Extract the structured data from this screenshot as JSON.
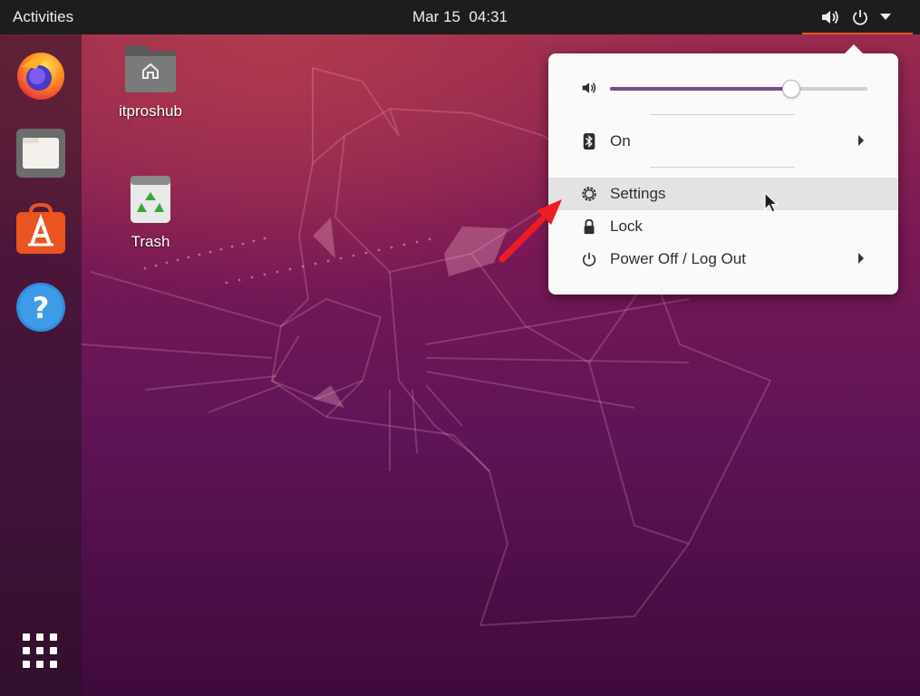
{
  "topbar": {
    "activities_label": "Activities",
    "date": "Mar 15",
    "time": "04:31",
    "tray_icons": [
      "volume-icon",
      "power-icon",
      "dropdown-arrow-icon"
    ],
    "accent": "#e95420"
  },
  "dock": {
    "items": [
      "firefox-icon",
      "files-icon",
      "software-icon",
      "help-icon"
    ],
    "show_apps_icon": "app-grid-icon"
  },
  "desktop": {
    "icons": [
      {
        "label": "itproshub",
        "icon": "home-folder-icon"
      },
      {
        "label": "Trash",
        "icon": "trash-icon"
      }
    ]
  },
  "menu": {
    "volume": {
      "icon": "volume-icon",
      "level_percent": 70
    },
    "bluetooth": {
      "icon": "bluetooth-icon",
      "label": "On"
    },
    "settings": {
      "icon": "settings-gear-icon",
      "label": "Settings"
    },
    "lock": {
      "icon": "lock-icon",
      "label": "Lock"
    },
    "power": {
      "icon": "power-icon",
      "label": "Power Off / Log Out"
    }
  },
  "colors": {
    "menu_bg": "#fafafa",
    "topbar_bg": "#1d1d1d",
    "slider_fill": "#7a4a8c",
    "highlight": "#e3e3e3",
    "annotation_arrow": "#ee1c25"
  }
}
